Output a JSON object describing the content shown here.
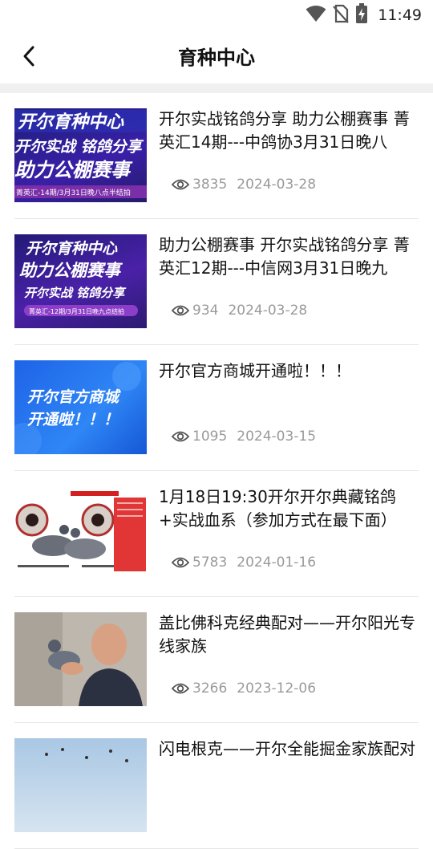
{
  "status_bar": {
    "time": "11:49",
    "icons": [
      "wifi-icon",
      "no-sim-icon",
      "battery-charging-icon"
    ]
  },
  "header": {
    "title": "育种中心",
    "back_icon": "chevron-left-icon"
  },
  "articles": [
    {
      "title": "开尔实战铭鸽分享 助力公棚赛事 菁英汇14期---中鸽协3月31日晚八",
      "views": "3835",
      "date": "2024-03-28",
      "thumb": {
        "line1": "开尔育种中心",
        "line2": "开尔实战 铭鸽分享",
        "line3": "助力公棚赛事",
        "footer": "菁英汇-14期/3月31日晚八点半结拍"
      }
    },
    {
      "title": "助力公棚赛事 开尔实战铭鸽分享 菁英汇12期---中信网3月31日晚九",
      "views": "934",
      "date": "2024-03-28",
      "thumb": {
        "line1": "开尔育种中心",
        "line2": "助力公棚赛事",
        "line3": "开尔实战 铭鸽分享",
        "footer": "菁英汇-12期/3月31日晚九点结拍"
      }
    },
    {
      "title": "开尔官方商城开通啦！！！",
      "views": "1095",
      "date": "2024-03-15",
      "thumb": {
        "line1": "开尔官方商城",
        "line2": "开通啦！！！"
      }
    },
    {
      "title": "1月18日19:30开尔开尔典藏铭鸽+实战血系（参加方式在最下面）",
      "views": "5783",
      "date": "2024-01-16",
      "thumb": {}
    },
    {
      "title": "盖比佛科克经典配对——开尔阳光专线家族",
      "views": "3266",
      "date": "2023-12-06",
      "thumb": {}
    },
    {
      "title": "闪电根克——开尔全能掘金家族配对",
      "views": "",
      "date": "",
      "thumb": {}
    }
  ]
}
